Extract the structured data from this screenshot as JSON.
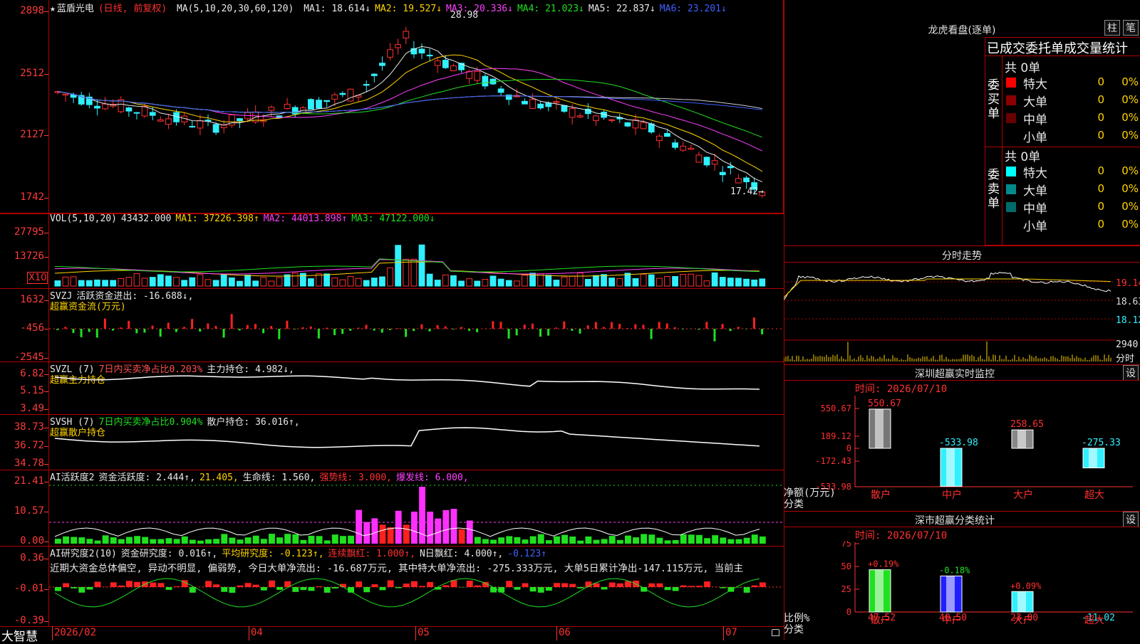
{
  "main_chart": {
    "star": "★",
    "stock_name": "蓝盾光电",
    "period": "(日线, 前复权)",
    "ma_label": "MA(5,10,20,30,60,120)",
    "ma_values": [
      {
        "label": "MA1:",
        "value": "18.614",
        "arrow": "↓",
        "color": "#e8e8e8"
      },
      {
        "label": "MA2:",
        "value": "19.527",
        "arrow": "↓",
        "color": "#ffd400"
      },
      {
        "label": "MA3:",
        "value": "20.336",
        "arrow": "↓",
        "color": "#ff40ff"
      },
      {
        "label": "MA4:",
        "value": "21.023",
        "arrow": "↓",
        "color": "#20e020"
      },
      {
        "label": "MA5:",
        "value": "22.837",
        "arrow": "↓",
        "color": "#e8e8e8"
      },
      {
        "label": "MA6:",
        "value": "23.201",
        "arrow": "↓",
        "color": "#4060ff"
      }
    ],
    "y_labels": [
      "2898",
      "2512",
      "2127",
      "1742"
    ],
    "high_label": "28.98",
    "low_label": "17.42→"
  },
  "vol": {
    "label": "VOL(5,10,20)",
    "value": "43432.000",
    "ma1": "MA1: 37226.398↑",
    "ma2": "MA2: 44013.898↑",
    "ma3": "MA3: 47122.000↓",
    "y_labels": [
      "27795",
      "13726"
    ],
    "unit": "X10"
  },
  "svzj": {
    "label": "SVZJ",
    "line1": "活跃资金进出: -16.688↓,",
    "line2": "超赢资金流(万元)",
    "y_labels": [
      "1632",
      "-456",
      "-2545"
    ]
  },
  "svzl": {
    "label": "SVZL  (7)",
    "part1": "7日内买卖净占比0.203%",
    "part2": "主力持仓: 4.982↓,",
    "line2": "超赢主力持仓",
    "y_labels": [
      "6.82",
      "5.15",
      "3.49"
    ]
  },
  "svsh": {
    "label": "SVSH  (7)",
    "part1": "7日内买卖净占比0.904%",
    "part2": "散户持仓: 36.016↑,",
    "line2": "超赢散户持仓",
    "y_labels": [
      "38.73",
      "36.72",
      "34.78"
    ]
  },
  "ai_active": {
    "label": "AI活跃度2",
    "part1": "资金活跃度: 2.444↑,",
    "part2": "21.405,",
    "part3": "生命线: 1.560,",
    "part4": "强势线: 3.000,",
    "part5": "爆发线: 6.000,",
    "y_labels": [
      "21.41",
      "10.57",
      "0.00"
    ]
  },
  "ai_research": {
    "label": "AI研究度2(10)",
    "part1": "资金研究度: 0.016↑,",
    "part2": "平均研究度: -0.123↑,",
    "part3": "连续飘红: 1.000↑,",
    "part4": "N日飘红: 4.000↑,",
    "part5": "-0.123↑",
    "desc": "近期大资金总体偏空, 异动不明显, 偏弱势, 今日大单净流出: -16.687万元, 其中特大单净流出: -275.333万元, 大单5日累计净出-147.115万元, 当前主",
    "y_labels": [
      "0.36",
      "-0.01",
      "-0.39"
    ]
  },
  "bottom_axis": {
    "brand": "大智慧",
    "months": [
      "2026/02",
      "04",
      "05",
      "06",
      "07"
    ]
  },
  "dragon_tiger": {
    "title": "龙虎看盘(逐单)",
    "btn1": "柱",
    "btn2": "笔",
    "header": "已成交委托单成交量统计",
    "buy": {
      "side_label": "委买单",
      "total": "共 0单",
      "rows": [
        {
          "name": "特大",
          "count": "0",
          "pct": "0%",
          "color": "#ff0000"
        },
        {
          "name": "大单",
          "count": "0",
          "pct": "0%",
          "color": "#8b0000"
        },
        {
          "name": "中单",
          "count": "0",
          "pct": "0%",
          "color": "#6b0000"
        },
        {
          "name": "小单",
          "count": "0",
          "pct": "0%",
          "color": "#000000"
        }
      ]
    },
    "sell": {
      "side_label": "委卖单",
      "total": "共 0单",
      "rows": [
        {
          "name": "特大",
          "count": "0",
          "pct": "0%",
          "color": "#00ffff"
        },
        {
          "name": "大单",
          "count": "0",
          "pct": "0%",
          "color": "#008b8b"
        },
        {
          "name": "中单",
          "count": "0",
          "pct": "0%",
          "color": "#006b6b"
        },
        {
          "name": "小单",
          "count": "0",
          "pct": "0%",
          "color": "#000000"
        }
      ]
    }
  },
  "intraday": {
    "title": "分时走势",
    "prices": [
      "19.14",
      "18.63",
      "18.12"
    ],
    "vol_label": "2940",
    "vol_unit": "分时"
  },
  "sz_monitor": {
    "title": "深圳超赢实时监控",
    "btn": "设",
    "time": "时间: 2026/07/10",
    "y_labels": [
      "550.67",
      "189.12",
      "0",
      "-172.43",
      "-533.98"
    ],
    "ylabel": "净额(万元)",
    "xlabel": "分类",
    "bars": [
      {
        "category": "散户",
        "value": 550.67,
        "label": "550.67"
      },
      {
        "category": "中户",
        "value": -533.98,
        "label": "-533.98"
      },
      {
        "category": "大户",
        "value": 258.65,
        "label": "258.65"
      },
      {
        "category": "超大",
        "value": -275.33,
        "label": "-275.33"
      }
    ]
  },
  "sz_class": {
    "title": "深市超赢分类统计",
    "btn": "设",
    "time": "时间: 2026/07/10",
    "y_labels": [
      "75",
      "50",
      "25",
      "0"
    ],
    "ylabel": "比例%",
    "xlabel": "分类",
    "bars": [
      {
        "category": "散户",
        "value": 47.52,
        "label": "47.52",
        "change": "+0.19%"
      },
      {
        "category": "中户",
        "value": 40.5,
        "label": "40.50",
        "change": "-0.18%"
      },
      {
        "category": "大户",
        "value": 23.0,
        "label": "23.00",
        "change": "+0.09%"
      },
      {
        "category": "超大",
        "value": -11.02,
        "label": "-11.02",
        "change": ""
      }
    ]
  },
  "chart_data": {
    "type": "bar",
    "title": "深圳超赢实时监控",
    "categories": [
      "散户",
      "中户",
      "大户",
      "超大"
    ],
    "series": [
      {
        "name": "净额(万元)",
        "values": [
          550.67,
          -533.98,
          258.65,
          -275.33
        ]
      },
      {
        "name": "比例%",
        "values": [
          47.52,
          40.5,
          23.0,
          -11.02
        ]
      }
    ],
    "ylabel": "净额(万元)"
  }
}
